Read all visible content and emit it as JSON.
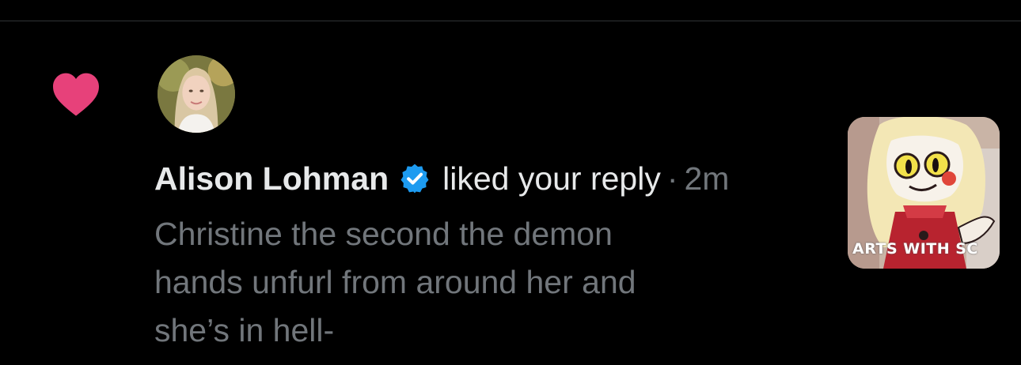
{
  "colors": {
    "background": "#000000",
    "like": "#e7417a",
    "verified": "#1d9bf0",
    "primary_text": "#e7e9ea",
    "secondary_text": "#71767b",
    "divider": "#2f3336"
  },
  "notification": {
    "type_icon": "heart-icon",
    "avatar_icon": "user-avatar",
    "author_name": "Alison Lohman",
    "verified_icon": "verified-badge-icon",
    "action": "liked your reply",
    "separator": "·",
    "timestamp": "2m",
    "reply_lines": [
      "Christine the second the demon",
      "hands unfurl from around her and",
      "she’s in hell-"
    ],
    "thumbnail": {
      "watermark": "ARTS WITH SC"
    }
  }
}
